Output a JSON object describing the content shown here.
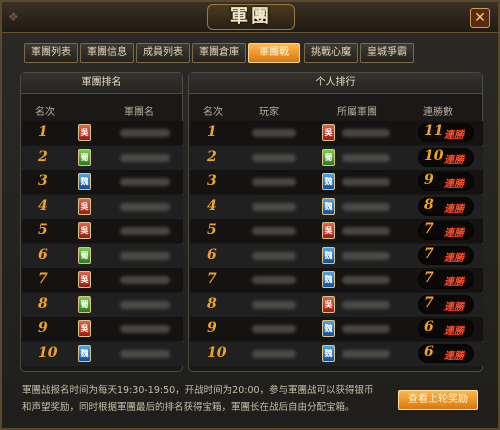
{
  "window": {
    "title": "軍團",
    "close_glyph": "✕"
  },
  "tabs": [
    {
      "label": "軍團列表"
    },
    {
      "label": "軍團信息"
    },
    {
      "label": "成員列表"
    },
    {
      "label": "軍團倉庫"
    },
    {
      "label": "軍團戰"
    },
    {
      "label": "挑戰心魔"
    },
    {
      "label": "皇城爭霸"
    }
  ],
  "active_tab": "軍團戰",
  "left_panel": {
    "title": "軍團排名",
    "col_rank": "名次",
    "col_guild": "軍團名",
    "rows": [
      {
        "rank": "1",
        "faction": "吳"
      },
      {
        "rank": "2",
        "faction": "蜀"
      },
      {
        "rank": "3",
        "faction": "魏"
      },
      {
        "rank": "4",
        "faction": "吳"
      },
      {
        "rank": "5",
        "faction": "吳"
      },
      {
        "rank": "6",
        "faction": "蜀"
      },
      {
        "rank": "7",
        "faction": "吳"
      },
      {
        "rank": "8",
        "faction": "蜀"
      },
      {
        "rank": "9",
        "faction": "吳"
      },
      {
        "rank": "10",
        "faction": "魏"
      }
    ]
  },
  "right_panel": {
    "title": "个人排行",
    "col_rank": "名次",
    "col_player": "玩家",
    "col_guild": "所屬軍團",
    "col_streak": "連勝數",
    "streak_label": "連勝",
    "rows": [
      {
        "rank": "1",
        "faction": "吳",
        "streak": "11"
      },
      {
        "rank": "2",
        "faction": "蜀",
        "streak": "10"
      },
      {
        "rank": "3",
        "faction": "魏",
        "streak": "9"
      },
      {
        "rank": "4",
        "faction": "魏",
        "streak": "8"
      },
      {
        "rank": "5",
        "faction": "吳",
        "streak": "7"
      },
      {
        "rank": "6",
        "faction": "魏",
        "streak": "7"
      },
      {
        "rank": "7",
        "faction": "魏",
        "streak": "7"
      },
      {
        "rank": "8",
        "faction": "吳",
        "streak": "7"
      },
      {
        "rank": "9",
        "faction": "魏",
        "streak": "6"
      },
      {
        "rank": "10",
        "faction": "魏",
        "streak": "6"
      }
    ]
  },
  "faction_colors": {
    "吳": "#c0392b",
    "蜀": "#4a9a2a",
    "魏": "#2a6fc0"
  },
  "footer": {
    "line1": "軍團战报名时间为每天19:30-19:50，开战时间为20:00，参与軍團战可以获得银币",
    "line2": "和声望奖励，同时根据軍團最后的排名获得宝箱，軍團长在战后自由分配宝箱。",
    "button_label": "查看上轮奖励"
  }
}
